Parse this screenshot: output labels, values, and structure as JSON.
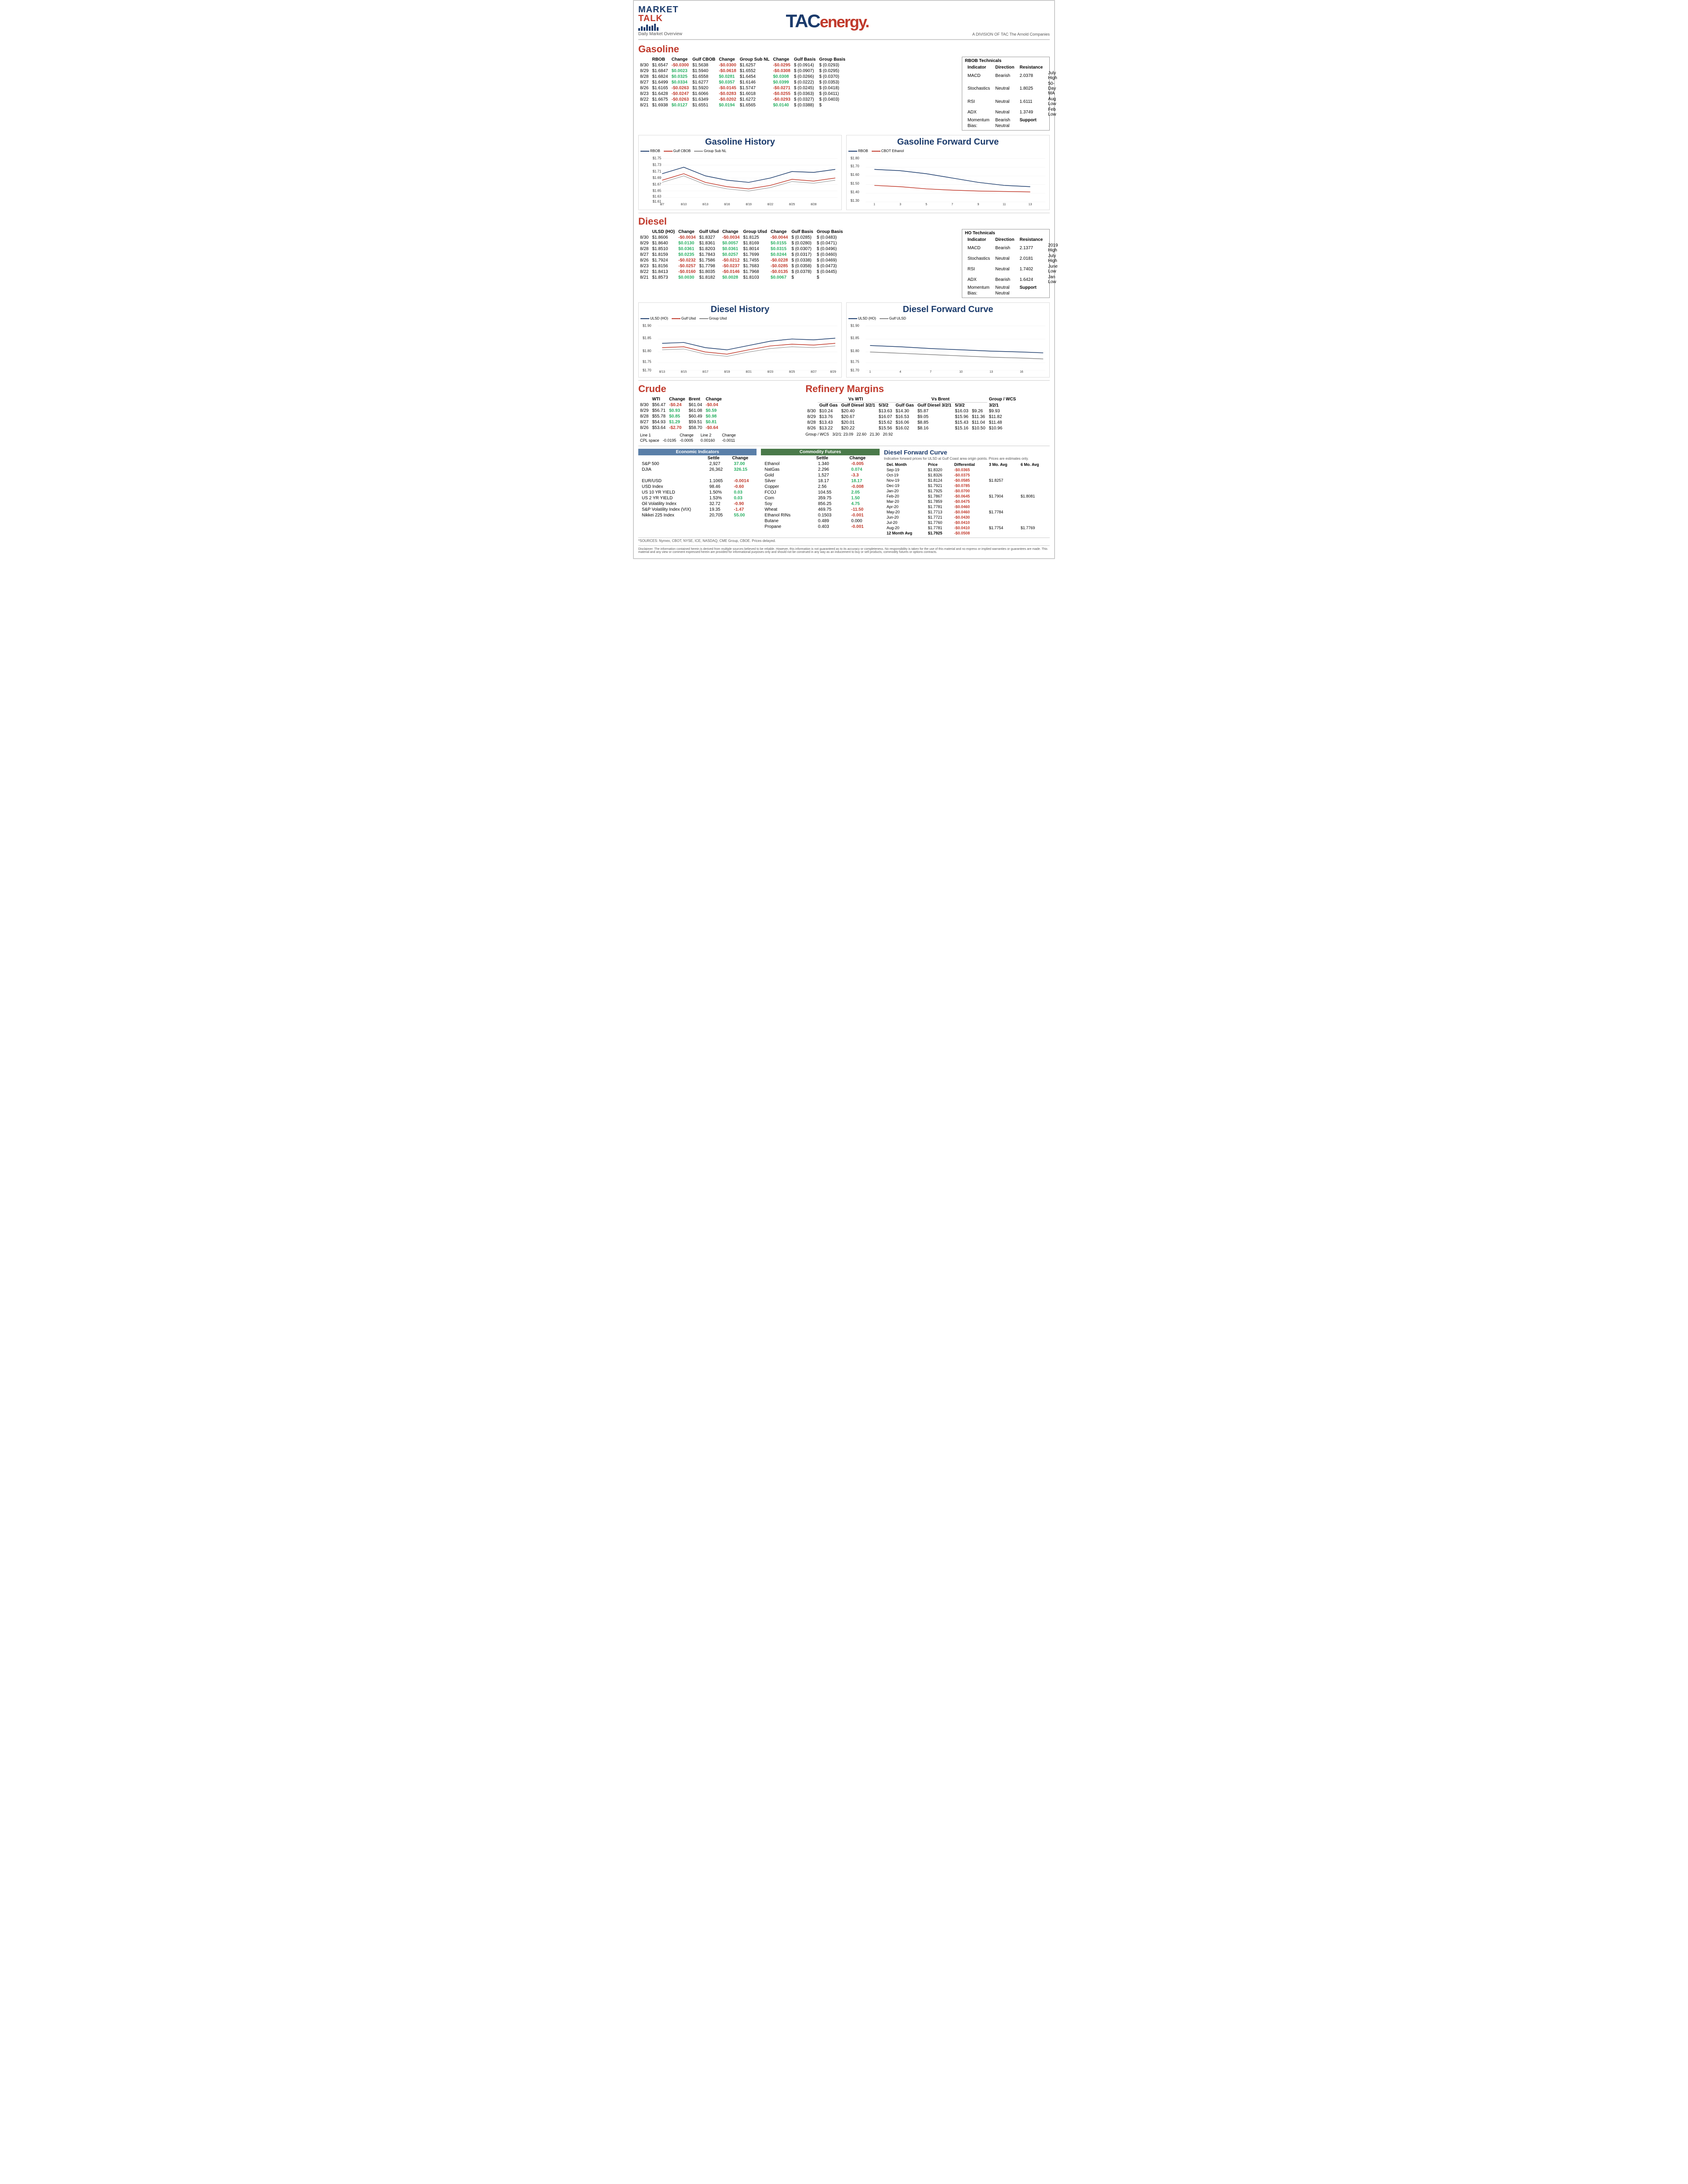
{
  "header": {
    "brand": "MARKET TALK",
    "subtitle": "Daily Market Overview",
    "tac_logo": "TACenergy.",
    "division": "A DIVISION OF TAC The Arnold Companies"
  },
  "gasoline": {
    "title": "Gasoline",
    "columns": [
      "",
      "RBOB",
      "Change",
      "Gulf CBOB",
      "Change",
      "Group Sub NL",
      "Change",
      "Gulf Basis",
      "Group Basis"
    ],
    "rows": [
      {
        "date": "8/30",
        "rbob": "$1.6547",
        "rbob_chg": "-$0.0300",
        "gcbob": "$1.5638",
        "gcbob_chg": "-$0.0300",
        "grpnl": "$1.6257",
        "grpnl_chg": "-$0.0295",
        "gulf_basis": "$ (0.0914)",
        "group_basis": "$ (0.0293)"
      },
      {
        "date": "8/29",
        "rbob": "$1.6847",
        "rbob_chg": "$0.0023",
        "gcbob": "$1.5940",
        "gcbob_chg": "-$0.0618",
        "grpnl": "$1.6552",
        "grpnl_chg": "-$0.0308",
        "gulf_basis": "$ (0.0907)",
        "group_basis": "$ (0.0295)"
      },
      {
        "date": "8/28",
        "rbob": "$1.6824",
        "rbob_chg": "$0.0325",
        "gcbob": "$1.6558",
        "gcbob_chg": "$0.0281",
        "grpnl": "$1.6454",
        "grpnl_chg": "$0.0308",
        "gulf_basis": "$ (0.0266)",
        "group_basis": "$ (0.0370)"
      },
      {
        "date": "8/27",
        "rbob": "$1.6499",
        "rbob_chg": "$0.0334",
        "gcbob": "$1.6277",
        "gcbob_chg": "$0.0357",
        "grpnl": "$1.6146",
        "grpnl_chg": "$0.0399",
        "gulf_basis": "$ (0.0222)",
        "group_basis": "$ (0.0353)"
      },
      {
        "date": "8/26",
        "rbob": "$1.6165",
        "rbob_chg": "-$0.0263",
        "gcbob": "$1.5920",
        "gcbob_chg": "-$0.0145",
        "grpnl": "$1.5747",
        "grpnl_chg": "-$0.0271",
        "gulf_basis": "$ (0.0245)",
        "group_basis": "$ (0.0418)"
      },
      {
        "date": "8/23",
        "rbob": "$1.6428",
        "rbob_chg": "-$0.0247",
        "gcbob": "$1.6066",
        "gcbob_chg": "-$0.0283",
        "grpnl": "$1.6018",
        "grpnl_chg": "-$0.0255",
        "gulf_basis": "$ (0.0363)",
        "group_basis": "$ (0.0411)"
      },
      {
        "date": "8/22",
        "rbob": "$1.6675",
        "rbob_chg": "-$0.0263",
        "gcbob": "$1.6349",
        "gcbob_chg": "-$0.0202",
        "grpnl": "$1.6272",
        "grpnl_chg": "-$0.0293",
        "gulf_basis": "$ (0.0327)",
        "group_basis": "$ (0.0403)"
      },
      {
        "date": "8/21",
        "rbob": "$1.6938",
        "rbob_chg": "$0.0127",
        "gcbob": "$1.6551",
        "gcbob_chg": "$0.0194",
        "grpnl": "$1.6565",
        "grpnl_chg": "$0.0140",
        "gulf_basis": "$ (0.0388)",
        "group_basis": "$"
      }
    ],
    "technicals": {
      "title": "RBOB Technicals",
      "indicators": [
        {
          "name": "Indicator",
          "direction": "Direction",
          "resistance": "Resistance"
        },
        {
          "name": "MACD",
          "direction": "Bearish",
          "val1": "2.0378",
          "label1": "July High"
        },
        {
          "name": "Stochastics",
          "direction": "Neutral",
          "val1": "1.8025",
          "label1": "50-Day MA"
        },
        {
          "name": "RSI",
          "direction": "Neutral",
          "val1": "1.6111",
          "label1": "Aug Low"
        },
        {
          "name": "ADX",
          "direction": "Neutral",
          "val1": "1.3749",
          "label1": "Feb Low"
        },
        {
          "name": "Momentum",
          "direction": "Bearish",
          "support": "Support"
        },
        {
          "name": "Bias:",
          "direction": "Neutral"
        }
      ]
    },
    "history_chart": {
      "title": "Gasoline History",
      "legend": [
        "RBOB",
        "Gulf CBOB",
        "Group Sub NL"
      ],
      "x_labels": [
        "8/7",
        "8/10",
        "8/13",
        "8/16",
        "8/19",
        "8/22",
        "8/25",
        "8/28"
      ],
      "y_min": 1.55,
      "y_max": 1.75
    },
    "forward_chart": {
      "title": "Gasoline Forward Curve",
      "legend": [
        "RBOB",
        "CBOT Ethanol"
      ],
      "x_labels": [
        "1",
        "3",
        "5",
        "7",
        "9",
        "11",
        "13"
      ],
      "y_min": 1.2,
      "y_max": 1.8
    }
  },
  "diesel": {
    "title": "Diesel",
    "columns": [
      "",
      "ULSD (HO)",
      "Change",
      "Gulf Ulsd",
      "Change",
      "Group Ulsd",
      "Change",
      "Gulf Basis",
      "Group Basis"
    ],
    "rows": [
      {
        "date": "8/30",
        "ulsd": "$1.8606",
        "ulsd_chg": "-$0.0034",
        "gulf_ulsd": "$1.8327",
        "gulf_chg": "-$0.0034",
        "grp_ulsd": "$1.8125",
        "grp_chg": "-$0.0044",
        "gulf_basis": "$ (0.0285)",
        "group_basis": "$ (0.0483)"
      },
      {
        "date": "8/29",
        "ulsd": "$1.8640",
        "ulsd_chg": "$0.0130",
        "gulf_ulsd": "$1.8361",
        "gulf_chg": "$0.0057",
        "grp_ulsd": "$1.8169",
        "grp_chg": "$0.0155",
        "gulf_basis": "$ (0.0280)",
        "group_basis": "$ (0.0471)"
      },
      {
        "date": "8/28",
        "ulsd": "$1.8510",
        "ulsd_chg": "$0.0361",
        "gulf_ulsd": "$1.8203",
        "gulf_chg": "$0.0361",
        "grp_ulsd": "$1.8014",
        "grp_chg": "$0.0315",
        "gulf_basis": "$ (0.0307)",
        "group_basis": "$ (0.0496)"
      },
      {
        "date": "8/27",
        "ulsd": "$1.8159",
        "ulsd_chg": "$0.0235",
        "gulf_ulsd": "$1.7843",
        "gulf_chg": "$0.0257",
        "grp_ulsd": "$1.7699",
        "grp_chg": "$0.0244",
        "gulf_basis": "$ (0.0317)",
        "group_basis": "$ (0.0460)"
      },
      {
        "date": "8/26",
        "ulsd": "$1.7924",
        "ulsd_chg": "-$0.0232",
        "gulf_ulsd": "$1.7586",
        "gulf_chg": "-$0.0212",
        "grp_ulsd": "$1.7455",
        "grp_chg": "-$0.0228",
        "gulf_basis": "$ (0.0338)",
        "group_basis": "$ (0.0469)"
      },
      {
        "date": "8/23",
        "ulsd": "$1.8156",
        "ulsd_chg": "-$0.0257",
        "gulf_ulsd": "$1.7798",
        "gulf_chg": "-$0.0237",
        "grp_ulsd": "$1.7683",
        "grp_chg": "-$0.0285",
        "gulf_basis": "$ (0.0358)",
        "group_basis": "$ (0.0473)"
      },
      {
        "date": "8/22",
        "ulsd": "$1.8413",
        "ulsd_chg": "-$0.0160",
        "gulf_ulsd": "$1.8035",
        "gulf_chg": "-$0.0146",
        "grp_ulsd": "$1.7968",
        "grp_chg": "-$0.0135",
        "gulf_basis": "$ (0.0378)",
        "group_basis": "$ (0.0445)"
      },
      {
        "date": "8/21",
        "ulsd": "$1.8573",
        "ulsd_chg": "$0.0030",
        "gulf_ulsd": "$1.8182",
        "gulf_chg": "$0.0028",
        "grp_ulsd": "$1.8103",
        "grp_chg": "$0.0067",
        "gulf_basis": "$",
        "group_basis": "$"
      }
    ],
    "technicals": {
      "title": "HO Technicals",
      "indicators": [
        {
          "name": "Indicator",
          "direction": "Direction",
          "resistance": "Resistance"
        },
        {
          "name": "MACD",
          "direction": "Bearish",
          "val1": "2.1377",
          "label1": "2019 High"
        },
        {
          "name": "Stochastics",
          "direction": "Neutral",
          "val1": "2.0181",
          "label1": "July High"
        },
        {
          "name": "RSI",
          "direction": "Neutral",
          "val1": "1.7402",
          "label1": "June Low"
        },
        {
          "name": "ADX",
          "direction": "Bearish",
          "val1": "1.6424",
          "label1": "Jan Low"
        },
        {
          "name": "Momentum",
          "direction": "Neutral",
          "support": "Support"
        },
        {
          "name": "Bias:",
          "direction": "Neutral"
        }
      ]
    },
    "history_chart": {
      "title": "Diesel History",
      "legend": [
        "ULSD (HO)",
        "Gulf Ulsd",
        "Group Ulsd"
      ],
      "x_labels": [
        "8/13",
        "8/15",
        "8/17",
        "8/19",
        "8/21",
        "8/23",
        "8/25",
        "8/27",
        "8/29"
      ],
      "y_min": 1.7,
      "y_max": 1.9
    },
    "forward_chart": {
      "title": "Diesel Forward Curve",
      "legend": [
        "ULSD (HO)",
        "Gulf ULSD"
      ],
      "x_labels": [
        "1",
        "4",
        "7",
        "10",
        "13",
        "16"
      ],
      "y_min": 1.7,
      "y_max": 1.9
    }
  },
  "crude": {
    "title": "Crude",
    "columns": [
      "",
      "WTI",
      "Change",
      "Brent",
      "Change"
    ],
    "rows": [
      {
        "date": "8/30",
        "wti": "$56.47",
        "wti_chg": "-$0.24",
        "brent": "$61.04",
        "brent_chg": "-$0.04"
      },
      {
        "date": "8/29",
        "wti": "$56.71",
        "wti_chg": "$0.93",
        "brent": "$61.08",
        "brent_chg": "$0.59"
      },
      {
        "date": "8/28",
        "wti": "$55.78",
        "wti_chg": "$0.85",
        "brent": "$60.49",
        "brent_chg": "$0.98"
      },
      {
        "date": "8/27",
        "wti": "$54.93",
        "wti_chg": "$1.29",
        "brent": "$59.51",
        "brent_chg": "$0.81"
      },
      {
        "date": "8/26",
        "wti": "$53.64",
        "wti_chg": "-$2.70",
        "brent": "$58.70",
        "brent_chg": "-$0.64"
      }
    ],
    "cpl": {
      "label": "CPL space",
      "line1": "Line 1",
      "line1_val": "-0.0195",
      "line2": "Change",
      "line2_val": "-0.0005",
      "line3": "Line 2",
      "line3_val": "0.00160",
      "line4": "Change",
      "line4_val": "-0.0011"
    }
  },
  "refinery": {
    "title": "Refinery Margins",
    "vs_wti_cols": [
      "",
      "Gulf Gas",
      "Gulf Diesel 3/2/1",
      "5/3/2"
    ],
    "vs_brent_cols": [
      "Gulf Gas",
      "Gulf Diesel 3/2/1",
      "5/3/2",
      "Group / WCS 3/2/1"
    ],
    "rows": [
      {
        "date": "8/30",
        "vswti_ggas": "$10.24",
        "vswti_gdiesel_321": "$20.40",
        "vswti_532": "$13.63",
        "vswti_grp": "$14.30",
        "vsbrent_ggas": "$5.87",
        "vsbrent_gdiesel_321": "$16.03",
        "vsbrent_532": "$9.26",
        "vsbrent_grp": "$9.93",
        "wcsgroupval": "23.09"
      },
      {
        "date": "8/29",
        "vswti_ggas": "$13.76",
        "vswti_gdiesel_321": "$20.67",
        "vswti_532": "$16.07",
        "vswti_grp": "$16.53",
        "vsbrent_ggas": "$9.05",
        "vsbrent_gdiesel_321": "$15.96",
        "vsbrent_532": "$11.36",
        "vsbrent_grp": "$11.82",
        "wcsgroupval": "22.60"
      },
      {
        "date": "8/28",
        "vswti_ggas": "$13.43",
        "vswti_gdiesel_321": "$20.01",
        "vswti_532": "$15.62",
        "vswti_grp": "$16.06",
        "vsbrent_ggas": "$8.85",
        "vsbrent_gdiesel_321": "$15.43",
        "vsbrent_532": "$11.04",
        "vsbrent_grp": "$11.48",
        "wcsgroupval": "21.30"
      },
      {
        "date": "8/26",
        "vswti_ggas": "$13.22",
        "vswti_gdiesel_321": "$20.22",
        "vswti_532": "$15.56",
        "vswti_grp": "$16.02",
        "vsbrent_ggas": "$8.16",
        "vsbrent_gdiesel_321": "$15.16",
        "vsbrent_532": "$10.50",
        "vsbrent_grp": "$10.96",
        "wcsgroupval": "20.92"
      }
    ]
  },
  "economic": {
    "title": "Economic Indicators",
    "columns": [
      "",
      "Settle",
      "Change"
    ],
    "rows": [
      {
        "name": "S&P 500",
        "settle": "2,927",
        "change": "37.00",
        "pos": true
      },
      {
        "name": "DJIA",
        "settle": "26,362",
        "change": "326.15",
        "pos": true
      },
      {
        "name": ""
      },
      {
        "name": "EUR/USD",
        "settle": "1.1065",
        "change": "-0.0014",
        "pos": false
      },
      {
        "name": "USD Index",
        "settle": "98.46",
        "change": "-0.60",
        "pos": false
      },
      {
        "name": "US 10 YR YIELD",
        "settle": "1.50%",
        "change": "0.03",
        "pos": true
      },
      {
        "name": "US 2 YR YIELD",
        "settle": "1.53%",
        "change": "0.03",
        "pos": true
      },
      {
        "name": "Oil Volatility Index",
        "settle": "32.72",
        "change": "-0.90",
        "pos": false
      },
      {
        "name": "S&P Volatility Index (VIX)",
        "settle": "19.35",
        "change": "-1.47",
        "pos": false
      },
      {
        "name": "Nikkei 225 Index",
        "settle": "20,705",
        "change": "55.00",
        "pos": true
      }
    ]
  },
  "commodity": {
    "title": "Commodity Futures",
    "columns": [
      "",
      "Settle",
      "Change"
    ],
    "rows": [
      {
        "name": "Ethanol",
        "settle": "1.340",
        "change": "-0.005",
        "pos": false
      },
      {
        "name": "NatGas",
        "settle": "2.296",
        "change": "0.074",
        "pos": true
      },
      {
        "name": "Gold",
        "settle": "1,527",
        "change": "-3.3",
        "pos": false
      },
      {
        "name": "Silver",
        "settle": "18.17",
        "change": "18.17",
        "pos": true
      },
      {
        "name": "Copper",
        "settle": "2.56",
        "change": "-0.008",
        "pos": false
      },
      {
        "name": "FCOJ",
        "settle": "104.55",
        "change": "2.05",
        "pos": true
      },
      {
        "name": "Corn",
        "settle": "359.75",
        "change": "1.50",
        "pos": true
      },
      {
        "name": "Soy",
        "settle": "856.25",
        "change": "4.75",
        "pos": true
      },
      {
        "name": "Wheat",
        "settle": "469.75",
        "change": "-11.50",
        "pos": false
      },
      {
        "name": "Ethanol RINs",
        "settle": "0.1503",
        "change": "-0.001",
        "pos": false
      },
      {
        "name": "Butane",
        "settle": "0.489",
        "change": "0.000",
        "pos": false
      },
      {
        "name": "Propane",
        "settle": "0.403",
        "change": "-0.001",
        "pos": false
      }
    ]
  },
  "diesel_forward": {
    "title": "Diesel Forward Curve",
    "subtitle": "Indicative forward prices for ULSD at Gulf Coast area origin points. Prices are estimates only.",
    "columns": [
      "Del. Month",
      "Price",
      "Differential",
      "3 Mo. Avg",
      "6 Mo. Avg"
    ],
    "rows": [
      {
        "month": "Sep-19",
        "price": "$1.8320",
        "diff": "-$0.0365",
        "avg3": "",
        "avg6": ""
      },
      {
        "month": "Oct-19",
        "price": "$1.8326",
        "diff": "-$0.0375",
        "avg3": "",
        "avg6": ""
      },
      {
        "month": "Nov-19",
        "price": "$1.8124",
        "diff": "-$0.0585",
        "avg3": "$1.8257",
        "avg6": ""
      },
      {
        "month": "Dec-19",
        "price": "$1.7921",
        "diff": "-$0.0785",
        "avg3": "",
        "avg6": ""
      },
      {
        "month": "Jan-20",
        "price": "$1.7925",
        "diff": "-$0.0700",
        "avg3": "",
        "avg6": ""
      },
      {
        "month": "Feb-20",
        "price": "$1.7867",
        "diff": "-$0.0645",
        "avg3": "$1.7904",
        "avg6": "$1.8081"
      },
      {
        "month": "Mar-20",
        "price": "$1.7859",
        "diff": "-$0.0475",
        "avg3": "",
        "avg6": ""
      },
      {
        "month": "Apr-20",
        "price": "$1.7781",
        "diff": "-$0.0460",
        "avg3": "",
        "avg6": ""
      },
      {
        "month": "May-20",
        "price": "$1.7713",
        "diff": "-$0.0460",
        "avg3": "$1.7784",
        "avg6": ""
      },
      {
        "month": "Jun-20",
        "price": "$1.7721",
        "diff": "-$0.0430",
        "avg3": "",
        "avg6": ""
      },
      {
        "month": "Jul-20",
        "price": "$1.7760",
        "diff": "-$0.0410",
        "avg3": "",
        "avg6": ""
      },
      {
        "month": "Aug-20",
        "price": "$1.7781",
        "diff": "-$0.0410",
        "avg3": "$1.7754",
        "avg6": "$1.7769"
      },
      {
        "month": "12 Month Avg",
        "price": "$1.7925",
        "diff": "-$0.0508",
        "avg3": "",
        "avg6": ""
      }
    ]
  },
  "sources": "*SOURCES: Nymex, CBOT, NYSE, ICE, NASDAQ, CME Group, CBOE.  Prices delayed.",
  "disclaimer": "Disclaimer: The information contained herein is derived from multiple sources believed to be reliable. However, this information is not guaranteed as to its accuracy or completeness. No responsibility is taken for the use of this material and no express or implied warranties or guarantees are made. This material and any view or comment expressed herein are provided for informational purposes only and should not be construed in any way as an inducement to buy or sell products, commodity futures or options contracts."
}
